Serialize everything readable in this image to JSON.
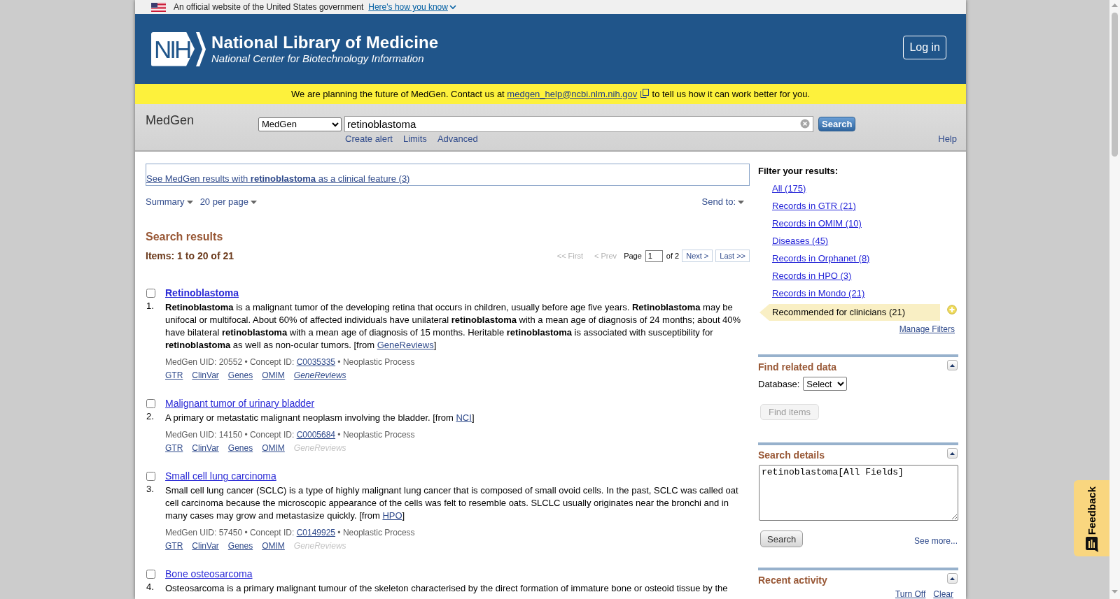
{
  "gov_banner": {
    "text": "An official website of the United States government",
    "link": "Here's how you know"
  },
  "header": {
    "logo": "NIH",
    "title": "National Library of Medicine",
    "subtitle": "National Center for Biotechnology Information",
    "login_button": "Log in"
  },
  "notice": {
    "text_before": "We are planning the future of MedGen. Contact us at",
    "email": "medgen_help@ncbi.nlm.nih.gov",
    "text_after": "to tell us how it can work better for you."
  },
  "search_bar": {
    "site_name": "MedGen",
    "database": "MedGen",
    "query": "retinoblastoma",
    "button": "Search",
    "links": [
      "Create alert",
      "Limits",
      "Advanced"
    ],
    "help": "Help"
  },
  "clinical_feature_link": "See MedGen results with **retinoblastoma** as a clinical feature (3)",
  "display_menus": [
    "Summary",
    "20 per page"
  ],
  "send_to": "Send to:",
  "results_heading": "Search results",
  "items_count": "Items: 1 to 20 of 21",
  "pager": {
    "back": [
      {
        "label": "<< First",
        "disabled": true
      },
      {
        "label": "< Prev",
        "disabled": true
      }
    ],
    "page_label": "Page",
    "page": "1",
    "page_total": "of 2",
    "forward": [
      {
        "label": "Next >",
        "disabled": false
      },
      {
        "label": "Last >>",
        "disabled": false
      }
    ]
  },
  "results": [
    {
      "number": "1.",
      "title": "Retinoblastoma",
      "match": true,
      "checked": false,
      "description": [
        {
          "kind": "text",
          "text": "**Retinoblastoma** is a malignant tumor of the developing retina that occurs in children, usually before age five years. **Retinoblastoma** may be unifocal or multifocal. About 60% of affected individuals have unilateral **retinoblastoma** with a mean age of diagnosis of 24 months; about 40% have bilateral **retinoblastoma** with a mean age of diagnosis of 15 months. Heritable **retinoblastoma** is associated with susceptibility for **retinoblastoma** as well as non-ocular tumors. [from "
        },
        {
          "kind": "link",
          "text": "GeneReviews"
        },
        {
          "kind": "text",
          "text": "]"
        }
      ],
      "meta": [
        {
          "kind": "text",
          "text": "MedGen UID: 20552 •  Concept ID: "
        },
        {
          "kind": "link",
          "text": "C0035335"
        },
        {
          "kind": "text",
          "text": " •  Neoplastic Process"
        }
      ],
      "links": [
        {
          "label": "GTR",
          "disabled": false
        },
        {
          "label": "ClinVar",
          "disabled": false
        },
        {
          "label": "Genes",
          "disabled": false
        },
        {
          "label": "OMIM",
          "disabled": false
        }
      ],
      "book_link": {
        "label": "GeneReviews",
        "disabled": false
      }
    },
    {
      "number": "2.",
      "title": "Malignant tumor of urinary bladder",
      "match": false,
      "checked": false,
      "description": [
        {
          "kind": "text",
          "text": "A primary or metastatic malignant neoplasm involving the bladder. [from "
        },
        {
          "kind": "link",
          "text": "NCI"
        },
        {
          "kind": "text",
          "text": "]"
        }
      ],
      "meta": [
        {
          "kind": "text",
          "text": "MedGen UID: 14150 •  Concept ID: "
        },
        {
          "kind": "link",
          "text": "C0005684"
        },
        {
          "kind": "text",
          "text": " •  Neoplastic Process"
        }
      ],
      "links": [
        {
          "label": "GTR",
          "disabled": false
        },
        {
          "label": "ClinVar",
          "disabled": false
        },
        {
          "label": "Genes",
          "disabled": false
        },
        {
          "label": "OMIM",
          "disabled": false
        }
      ],
      "book_link": {
        "label": "GeneReviews",
        "disabled": true
      }
    },
    {
      "number": "3.",
      "title": "Small cell lung carcinoma",
      "match": false,
      "checked": false,
      "description": [
        {
          "kind": "text",
          "text": "Small cell lung cancer (SCLC) is a type of highly malignant lung cancer that is composed of small ovoid cells. In the past, SCLC was called oat cell carcinoma because the microscopic appearance of the cells was felt to resemble oats. SLCLC usually originates near the bronchi and in many cases may grow and metastasize quickly. [from "
        },
        {
          "kind": "link",
          "text": "HPO"
        },
        {
          "kind": "text",
          "text": "]"
        }
      ],
      "meta": [
        {
          "kind": "text",
          "text": "MedGen UID: 57450 •  Concept ID: "
        },
        {
          "kind": "link",
          "text": "C0149925"
        },
        {
          "kind": "text",
          "text": " •  Neoplastic Process"
        }
      ],
      "links": [
        {
          "label": "GTR",
          "disabled": false
        },
        {
          "label": "ClinVar",
          "disabled": false
        },
        {
          "label": "Genes",
          "disabled": false
        },
        {
          "label": "OMIM",
          "disabled": false
        }
      ],
      "book_link": {
        "label": "GeneReviews",
        "disabled": true
      }
    },
    {
      "number": "4.",
      "title": "Bone osteosarcoma",
      "match": false,
      "checked": false,
      "description": [
        {
          "kind": "text",
          "text": "Osteosarcoma is a primary malignant tumour of the skeleton characterised by the direct formation of immature bone or osteoid tissue by the"
        }
      ]
    }
  ],
  "sidebar": {
    "filter_title": "Filter your results:",
    "filters": [
      {
        "label": "All (175)",
        "selected": false
      },
      {
        "label": "Records in GTR (21)",
        "selected": false
      },
      {
        "label": "Records in OMIM (10)",
        "selected": false
      },
      {
        "label": "Diseases (45)",
        "selected": false
      },
      {
        "label": "Records in Orphanet (8)",
        "selected": false
      },
      {
        "label": "Records in HPO (3)",
        "selected": false
      },
      {
        "label": "Records in Mondo (21)",
        "selected": false
      },
      {
        "label": "Recommended for clinicians (21)",
        "selected": true
      }
    ],
    "manage_filters": "Manage Filters",
    "portlets": [
      {
        "kind": "related",
        "title": "Find related data",
        "field_label": "Database:",
        "select": "Select",
        "button": {
          "label": "Find items",
          "disabled": true
        }
      },
      {
        "kind": "details",
        "title": "Search details",
        "query": "retinoblastoma[All Fields]",
        "button": {
          "label": "Search",
          "disabled": false
        },
        "link": "See more..."
      },
      {
        "kind": "recent",
        "title": "Recent activity",
        "links": [
          "Turn Off",
          "Clear"
        ]
      }
    ]
  },
  "feedback": "Feedback"
}
